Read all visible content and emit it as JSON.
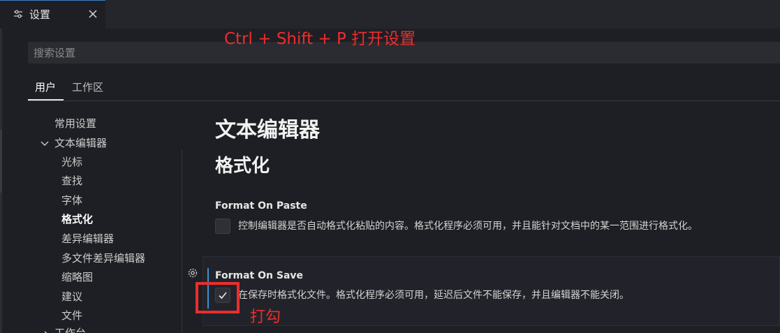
{
  "tab": {
    "icon": "settings-sliders-icon",
    "label": "设置",
    "close_icon": "close-icon"
  },
  "search": {
    "placeholder": "搜索设置"
  },
  "scope_tabs": {
    "user": "用户",
    "workspace": "工作区"
  },
  "tree": {
    "items": [
      {
        "label": "常用设置"
      },
      {
        "label": "文本编辑器",
        "expanded": true
      },
      {
        "label": "光标"
      },
      {
        "label": "查找"
      },
      {
        "label": "字体"
      },
      {
        "label": "格式化",
        "active": true
      },
      {
        "label": "差异编辑器"
      },
      {
        "label": "多文件差异编辑器"
      },
      {
        "label": "缩略图"
      },
      {
        "label": "建议"
      },
      {
        "label": "文件"
      },
      {
        "label": "工作台"
      }
    ]
  },
  "content": {
    "heading": "文本编辑器",
    "subheading": "格式化",
    "settings": [
      {
        "title": "Format On Paste",
        "description": "控制编辑器是否自动格式化粘贴的内容。格式化程序必须可用，并且能针对文档中的某一范围进行格式化。",
        "checked": false
      },
      {
        "title": "Format On Save",
        "description": "在保存时格式化文件。格式化程序必须可用，延迟后文件不能保存，并且编辑器不能关闭。",
        "checked": true
      }
    ]
  },
  "annotations": {
    "shortcut": "Ctrl + Shift + P  打开设置",
    "check_hint": "打勾"
  },
  "colors": {
    "accent": "#3c8fd6",
    "annotation_red": "#ee2d2d",
    "background": "#1e1f24"
  }
}
